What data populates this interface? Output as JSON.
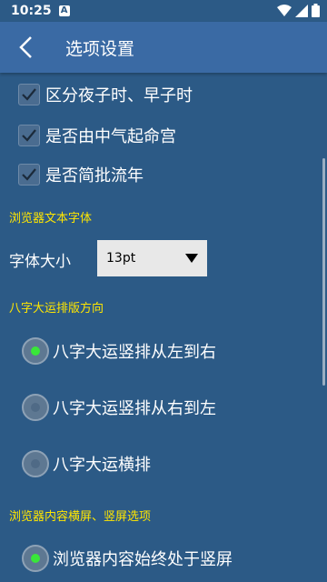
{
  "status_bar": {
    "time": "10:25",
    "notification_letter": "A"
  },
  "app_bar": {
    "title": "选项设置"
  },
  "checkboxes": [
    {
      "label": "区分夜子时、早子时",
      "checked": true
    },
    {
      "label": "是否由中气起命宫",
      "checked": true
    },
    {
      "label": "是否简批流年",
      "checked": true
    }
  ],
  "sections": {
    "browser_font": "浏览器文本字体",
    "bazi_layout": "八字大运排版方向",
    "browser_orientation": "浏览器内容横屏、竖屏选项"
  },
  "font_size": {
    "label": "字体大小",
    "selected": "13pt"
  },
  "bazi_options": [
    {
      "label": "八字大运竖排从左到右",
      "selected": true
    },
    {
      "label": "八字大运竖排从右到左",
      "selected": false
    },
    {
      "label": "八字大运横排",
      "selected": false
    }
  ],
  "orientation_options": [
    {
      "label": "浏览器内容始终处于竖屏",
      "selected": true
    }
  ],
  "colors": {
    "background": "#2c5a86",
    "app_bar": "#3a6aa4",
    "section_header": "#ffe600",
    "radio_on": "#39e639"
  }
}
